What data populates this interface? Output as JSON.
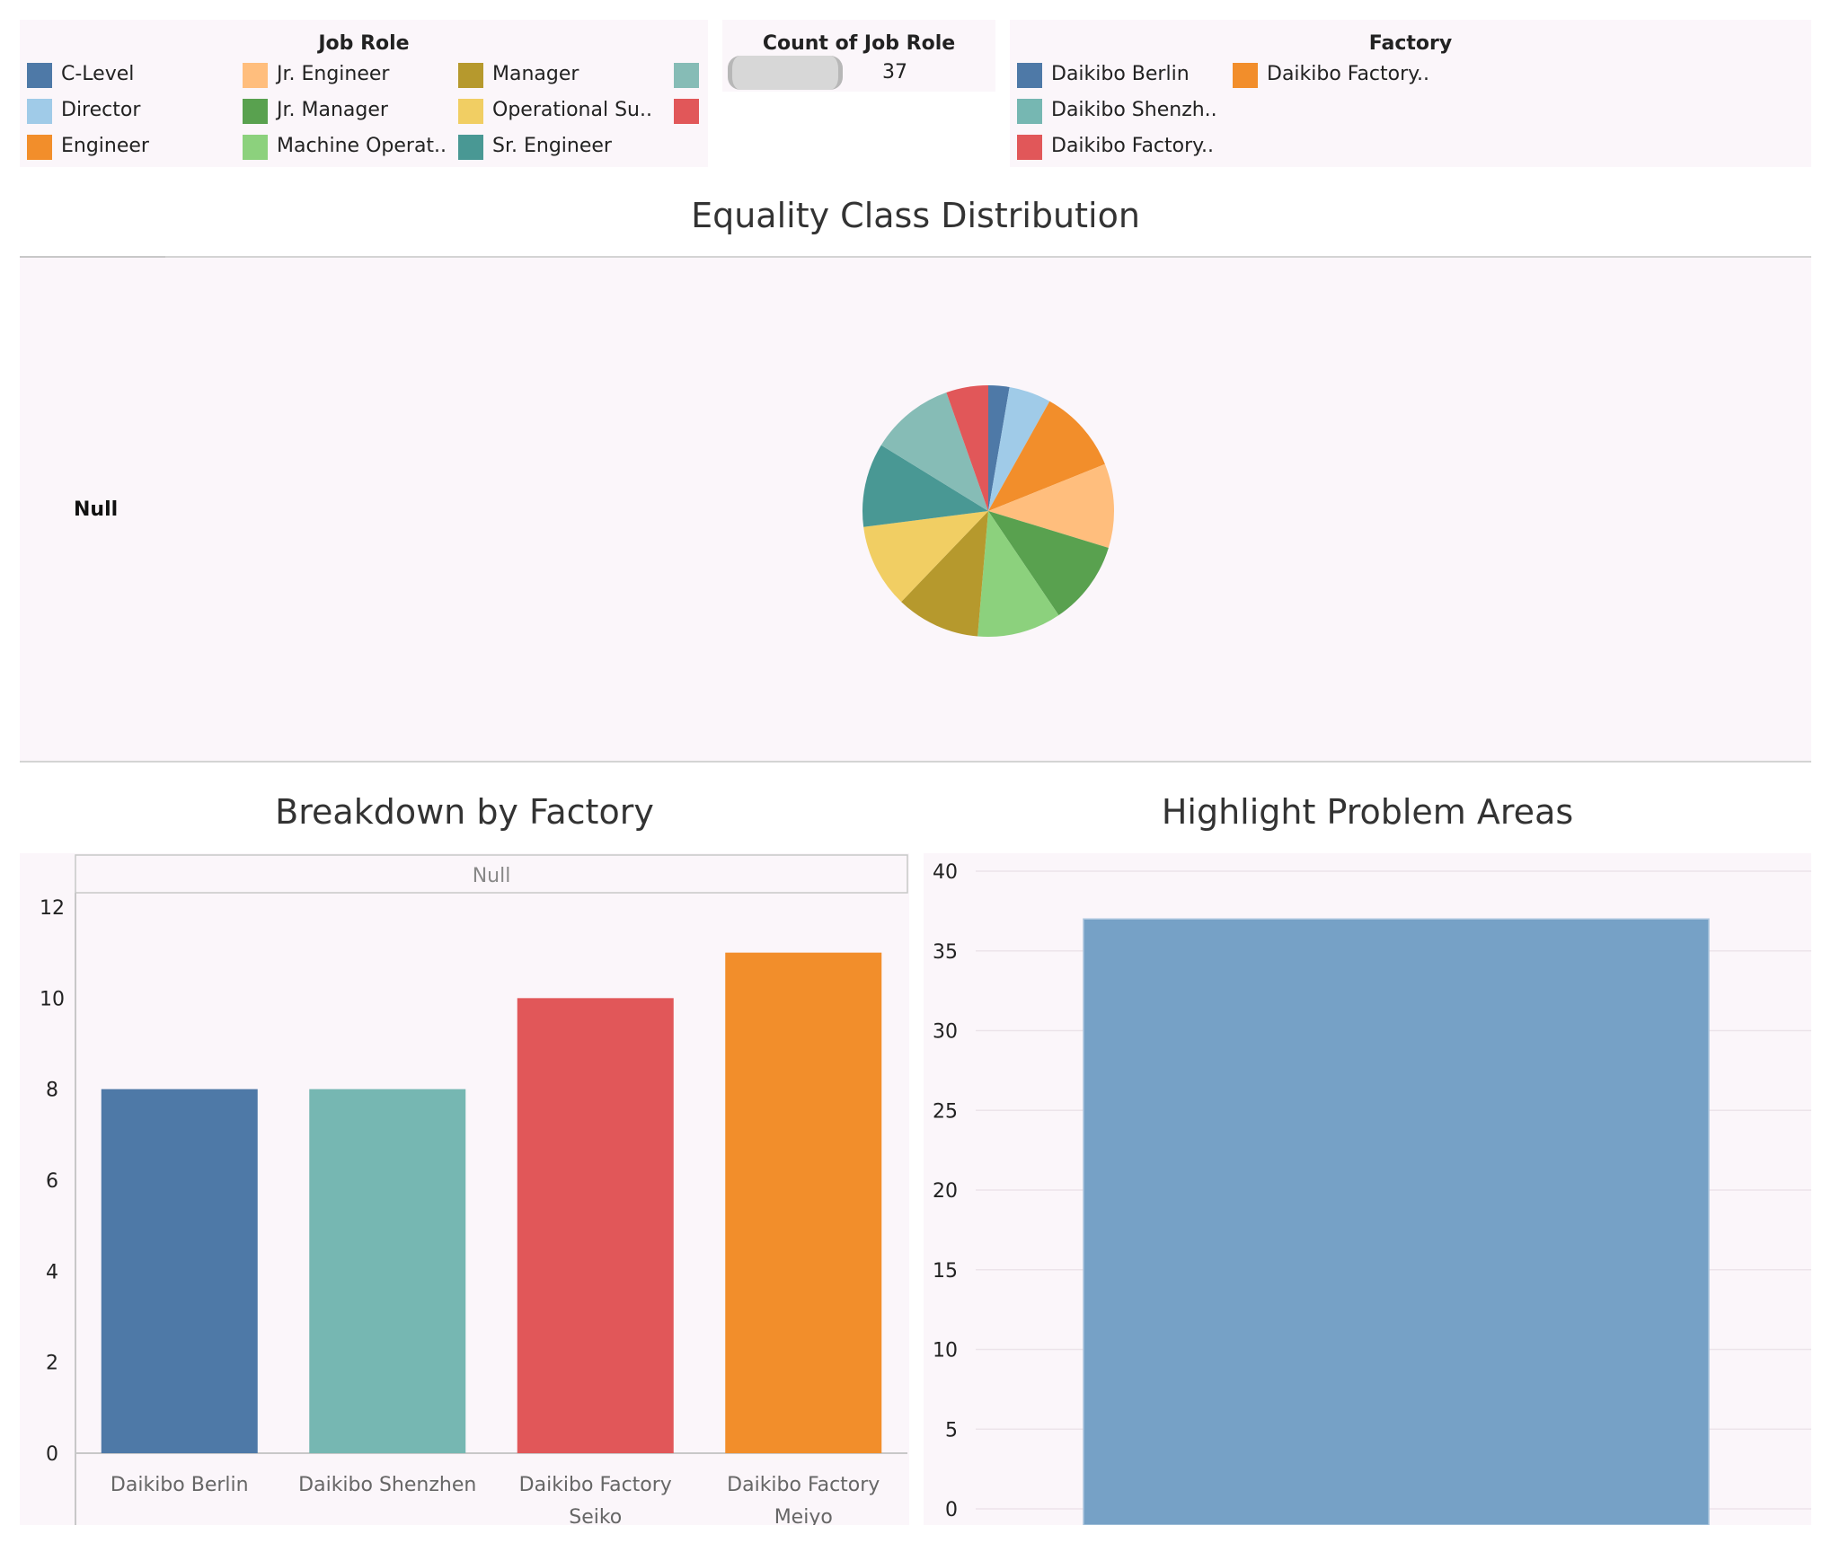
{
  "job_role_legend": {
    "title": "Job Role",
    "items": [
      {
        "label": "C-Level",
        "color": "#4e79a7"
      },
      {
        "label": "Director",
        "color": "#a0cbe8"
      },
      {
        "label": "Engineer",
        "color": "#f28e2b"
      },
      {
        "label": "Jr. Engineer",
        "color": "#ffbe7d"
      },
      {
        "label": "Jr. Manager",
        "color": "#59a14f"
      },
      {
        "label": "Machine Operat..",
        "color": "#8cd17d"
      },
      {
        "label": "Manager",
        "color": "#b6992d"
      },
      {
        "label": "Operational Su..",
        "color": "#f1ce63"
      },
      {
        "label": "Sr. Engineer",
        "color": "#499894"
      },
      {
        "label": "",
        "color": "#86bcb6"
      },
      {
        "label": "",
        "color": "#e15759"
      }
    ]
  },
  "count_filter": {
    "title": "Count of Job Role",
    "value": "37"
  },
  "factory_legend": {
    "title": "Factory",
    "items": [
      {
        "label": "Daikibo Berlin",
        "color": "#4e79a7"
      },
      {
        "label": "Daikibo Shenzh..",
        "color": "#76b7b2"
      },
      {
        "label": "Daikibo Factory..",
        "color": "#e15759"
      },
      {
        "label": "Daikibo Factory..",
        "color": "#f28e2b"
      }
    ]
  },
  "chart_data": [
    {
      "type": "pie",
      "title": "Equality Class Distribution",
      "row_label": "Null",
      "slices": [
        {
          "label": "C-Level",
          "value": 1,
          "color": "#4e79a7"
        },
        {
          "label": "Director",
          "value": 2,
          "color": "#a0cbe8"
        },
        {
          "label": "Engineer",
          "value": 4,
          "color": "#f28e2b"
        },
        {
          "label": "Jr. Engineer",
          "value": 4,
          "color": "#ffbe7d"
        },
        {
          "label": "Jr. Manager",
          "value": 4,
          "color": "#59a14f"
        },
        {
          "label": "Machine Operat..",
          "value": 4,
          "color": "#8cd17d"
        },
        {
          "label": "Manager",
          "value": 4,
          "color": "#b6992d"
        },
        {
          "label": "Operational Su..",
          "value": 4,
          "color": "#f1ce63"
        },
        {
          "label": "Sr. Engineer",
          "value": 4,
          "color": "#499894"
        },
        {
          "label": "",
          "value": 4,
          "color": "#86bcb6"
        },
        {
          "label": "",
          "value": 2,
          "color": "#e15759"
        }
      ]
    },
    {
      "type": "bar",
      "title": "Breakdown by Factory",
      "header": "Null",
      "categories": [
        [
          "Daikibo Berlin"
        ],
        [
          "Daikibo Shenzhen"
        ],
        [
          "Daikibo Factory",
          "Seiko"
        ],
        [
          "Daikibo Factory",
          "Meiyo"
        ]
      ],
      "values": [
        8,
        8,
        10,
        11
      ],
      "colors": [
        "#4e79a7",
        "#76b7b2",
        "#e15759",
        "#f28e2b"
      ],
      "ylim": [
        0,
        12
      ],
      "yticks": [
        0,
        2,
        4,
        6,
        8,
        10,
        12
      ]
    },
    {
      "type": "bar",
      "title": "Highlight Problem Areas",
      "categories": [
        ""
      ],
      "values": [
        37
      ],
      "colors": [
        "#76a1c6"
      ],
      "ylim": [
        0,
        40
      ],
      "yticks": [
        0,
        5,
        10,
        15,
        20,
        25,
        30,
        35,
        40
      ]
    }
  ]
}
